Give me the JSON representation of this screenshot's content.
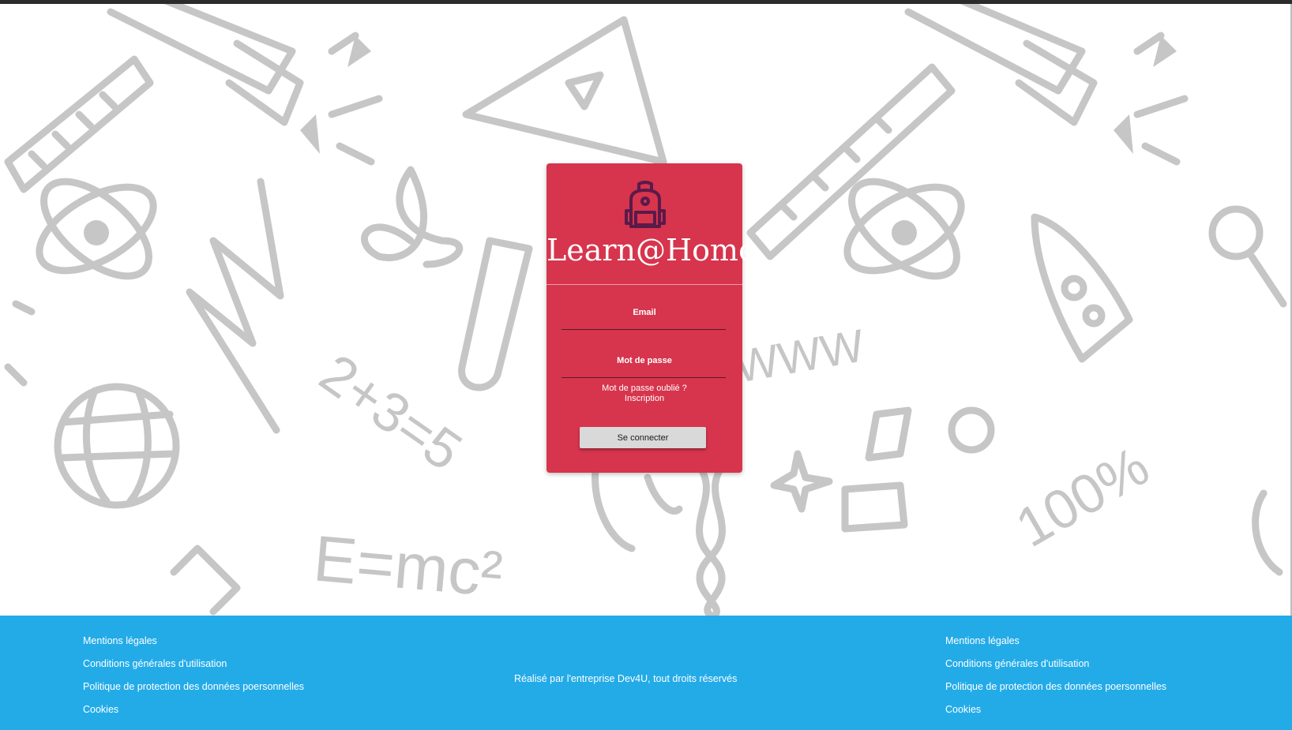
{
  "app": {
    "title": "Learn@Home",
    "icon": "backpack-icon"
  },
  "login": {
    "email_label": "Email",
    "password_label": "Mot de passe",
    "forgot_password": "Mot de passe oublié ?",
    "register": "Inscription",
    "submit_label": "Se connecter"
  },
  "footer": {
    "left_links": [
      "Mentions légales",
      "Conditions générales d'utilisation",
      "Politique de protection des données poersonnelles",
      "Cookies"
    ],
    "center_text": "Réalisé par l'entreprise Dev4U, tout droits réservés",
    "right_links": [
      "Mentions légales",
      "Conditions générales d'utilisation",
      "Politique de protection des données poersonnelles",
      "Cookies"
    ]
  },
  "background": {
    "doodle_text": [
      "E=mc²",
      "2+3=5",
      "WWW",
      "100%"
    ]
  },
  "colors": {
    "card": "#d6354d",
    "footer": "#23abe8",
    "doodle": "#c6c6c6",
    "logo": "#5a1a4a"
  }
}
